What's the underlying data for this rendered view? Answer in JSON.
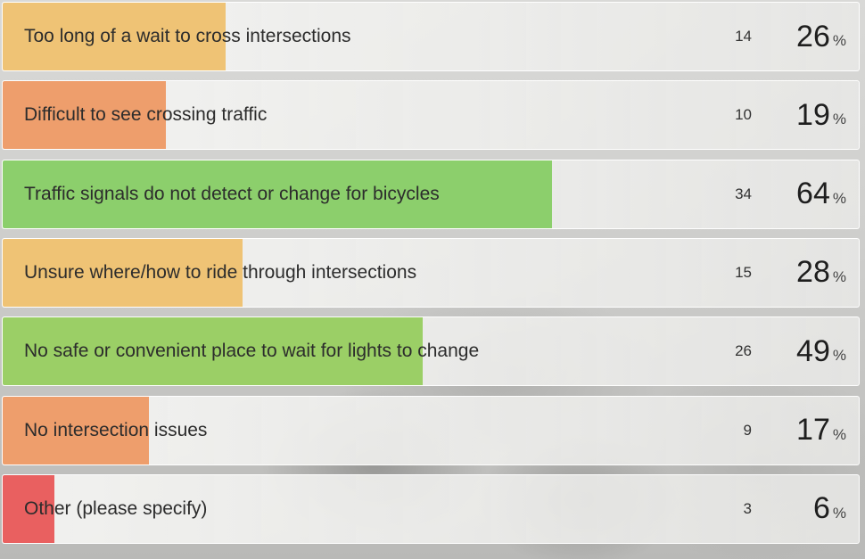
{
  "chart_data": {
    "type": "bar",
    "orientation": "horizontal",
    "categories": [
      "Too long of a wait to cross intersections",
      "Difficult to see crossing traffic",
      "Traffic signals do not detect or change for bicycles",
      "Unsure where/how to ride through intersections",
      "No safe or convenient place to wait for lights to change",
      "No intersection issues",
      "Other (please specify)"
    ],
    "counts": [
      14,
      10,
      34,
      15,
      26,
      9,
      3
    ],
    "values": [
      26,
      19,
      64,
      28,
      49,
      17,
      6
    ],
    "value_unit": "%",
    "bar_colors": [
      "#efc375",
      "#ee9e6c",
      "#8ccf6c",
      "#efc375",
      "#9bcf66",
      "#ee9e6c",
      "#e96060"
    ]
  },
  "percent_sign": "%"
}
